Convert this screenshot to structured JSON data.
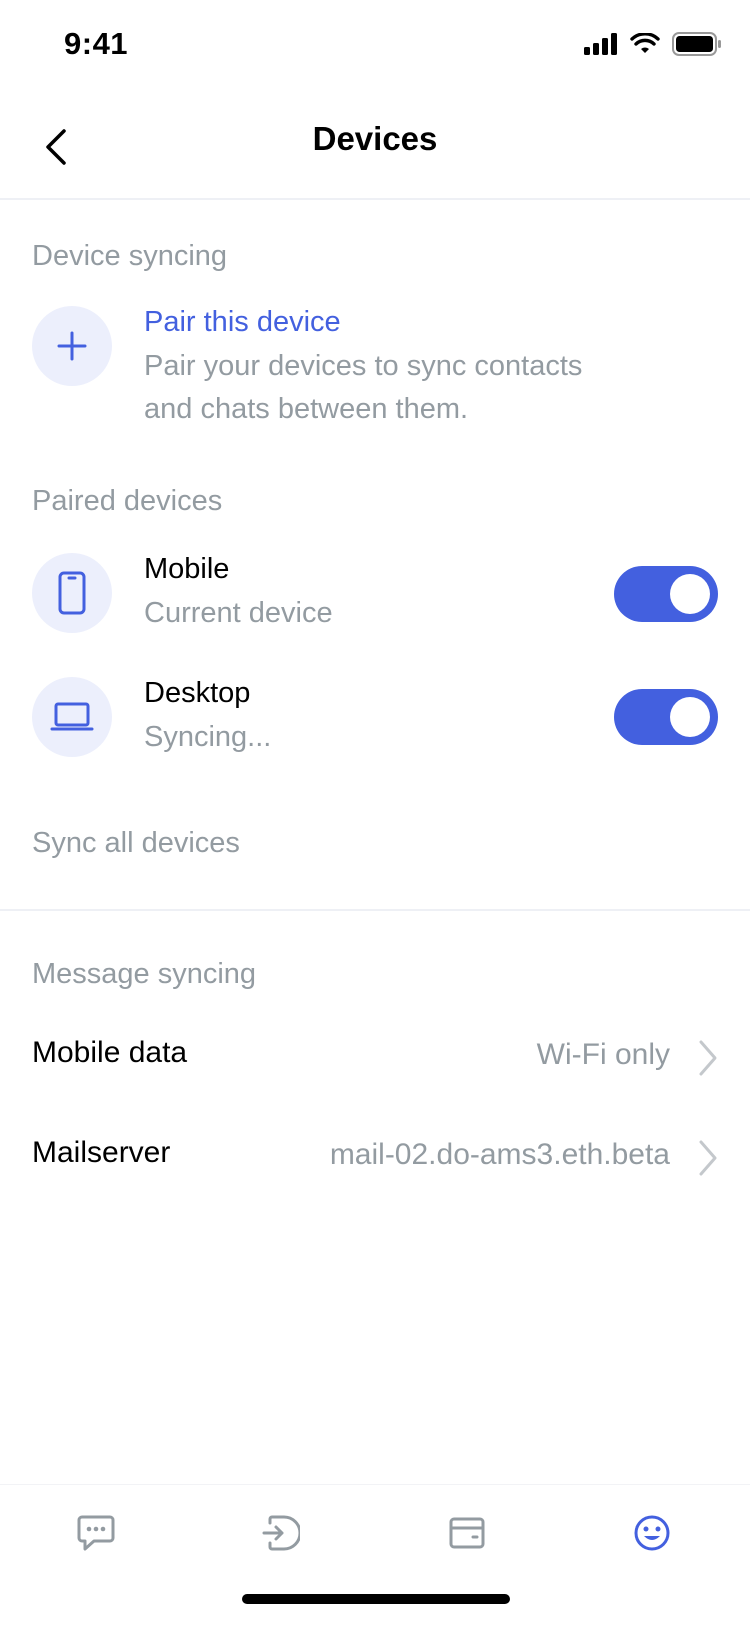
{
  "status_bar": {
    "time": "9:41"
  },
  "nav": {
    "title": "Devices"
  },
  "device_syncing": {
    "section_title": "Device syncing",
    "pair": {
      "title": "Pair this device",
      "description_line1": "Pair your devices to sync contacts",
      "description_line2": "and chats between them."
    }
  },
  "paired_devices": {
    "section_title": "Paired devices",
    "devices": [
      {
        "name": "Mobile",
        "status": "Current device",
        "enabled": true
      },
      {
        "name": "Desktop",
        "status": "Syncing...",
        "enabled": true
      }
    ],
    "sync_all_label": "Sync all devices"
  },
  "message_syncing": {
    "section_title": "Message syncing",
    "rows": [
      {
        "label": "Mobile data",
        "value": "Wi-Fi only"
      },
      {
        "label": "Mailserver",
        "value": "mail-02.do-ams3.eth.beta"
      }
    ]
  },
  "tabs": [
    {
      "icon": "chat-icon",
      "active": false
    },
    {
      "icon": "browser-icon",
      "active": false
    },
    {
      "icon": "wallet-icon",
      "active": false
    },
    {
      "icon": "profile-icon",
      "active": true
    }
  ],
  "colors": {
    "accent": "#4360df",
    "secondary_text": "#939ba1",
    "icon_bg": "#eceffc",
    "inactive_tab": "#939ba1"
  }
}
